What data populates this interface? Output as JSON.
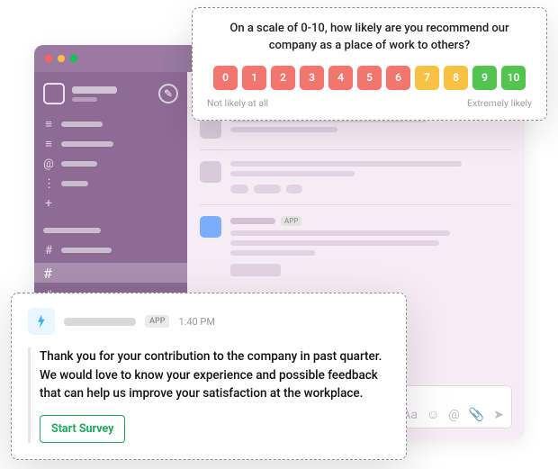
{
  "nps": {
    "question": "On a scale of 0-10, how likely are you recommend our company as a place of work to others?",
    "options": [
      {
        "label": "0",
        "tier": "low"
      },
      {
        "label": "1",
        "tier": "low"
      },
      {
        "label": "2",
        "tier": "low"
      },
      {
        "label": "3",
        "tier": "low"
      },
      {
        "label": "4",
        "tier": "low"
      },
      {
        "label": "5",
        "tier": "low"
      },
      {
        "label": "6",
        "tier": "low"
      },
      {
        "label": "7",
        "tier": "mid"
      },
      {
        "label": "8",
        "tier": "mid"
      },
      {
        "label": "9",
        "tier": "high"
      },
      {
        "label": "10",
        "tier": "high"
      }
    ],
    "low_caption": "Not likely at all",
    "high_caption": "Extremely likely"
  },
  "survey_message": {
    "app_tag": "APP",
    "time": "1:40 PM",
    "body": "Thank you for your contribution to the company in past quarter. We would love to know your experience and possible feedback that can help us improve your satisfaction at the workplace.",
    "cta": "Start Survey"
  },
  "colors": {
    "nps_low": "#f2766e",
    "nps_mid": "#f7c244",
    "nps_high": "#52c44f",
    "cta_green": "#1eab5a"
  },
  "slack": {
    "compose_icon": "✎",
    "app_tag": "APP",
    "sidebar_icons": [
      "≡",
      "≡",
      "@",
      "⋮"
    ],
    "channel_prefix": "#",
    "composer_icons": [
      "Aa",
      "☺",
      "@",
      "📎",
      "➤"
    ]
  }
}
